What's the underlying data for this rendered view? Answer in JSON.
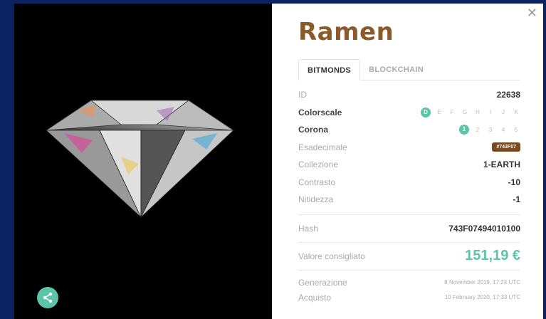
{
  "product": {
    "title": "Ramen"
  },
  "tabs": [
    {
      "label": "BITMONDS",
      "active": true
    },
    {
      "label": "BLOCKCHAIN",
      "active": false
    }
  ],
  "details": {
    "id_label": "ID",
    "id_value": "22638",
    "colorscale_label": "Colorscale",
    "colorscale_options": [
      "D",
      "E",
      "F",
      "G",
      "H",
      "I",
      "J",
      "K"
    ],
    "colorscale_selected": "D",
    "corona_label": "Corona",
    "corona_options": [
      "1",
      "2",
      "3",
      "4",
      "5"
    ],
    "corona_selected": "1",
    "hex_label": "Esadecimale",
    "hex_value": "#743F07",
    "collection_label": "Collezione",
    "collection_value": "1-EARTH",
    "contrast_label": "Contrasto",
    "contrast_value": "-10",
    "sharpness_label": "Nitidezza",
    "sharpness_value": "-1",
    "hash_label": "Hash",
    "hash_value": "743F07494010100",
    "suggested_label": "Valore consigliato",
    "suggested_value": "151,19 €",
    "generation_label": "Generazione",
    "generation_value": "8 November 2019, 17:24 UTC",
    "purchase_label": "Acquisto",
    "purchase_value": "10 February 2020, 17:33 UTC"
  },
  "colors": {
    "accent": "#5cc4a8",
    "title": "#8a5a2b",
    "badge": "#7a4a22",
    "backdrop": "#0d2260"
  },
  "icons": {
    "close": "close-icon",
    "share": "share-icon"
  }
}
